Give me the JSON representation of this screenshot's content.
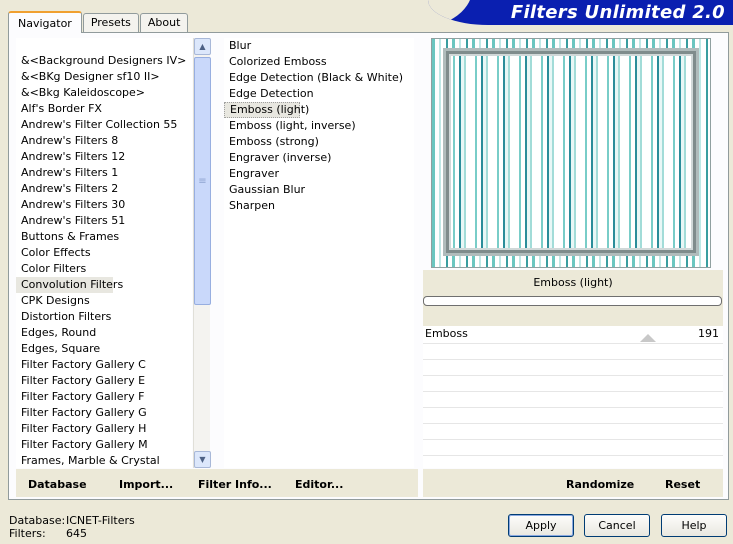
{
  "tabs": [
    {
      "label": "Navigator",
      "active": true
    },
    {
      "label": "Presets",
      "active": false
    },
    {
      "label": "About",
      "active": false
    }
  ],
  "brand": {
    "title": "Filters Unlimited 2.0",
    "color": "#0a1fb0"
  },
  "categories": {
    "items": [
      "&<Background Designers IV>",
      "&<BKg Designer sf10 II>",
      "&<Bkg Kaleidoscope>",
      "Alf's Border FX",
      "Andrew's Filter Collection 55",
      "Andrew's Filters  8",
      "Andrew's Filters 12",
      "Andrew's Filters 1",
      "Andrew's Filters 2",
      "Andrew's Filters 30",
      "Andrew's Filters 51",
      "Buttons & Frames",
      "Color Effects",
      "Color Filters",
      "Convolution Filters",
      "CPK Designs",
      "Distortion Filters",
      "Edges, Round",
      "Edges, Square",
      "Filter Factory Gallery C",
      "Filter Factory Gallery E",
      "Filter Factory Gallery F",
      "Filter Factory Gallery G",
      "Filter Factory Gallery H",
      "Filter Factory Gallery M",
      "Frames, Marble & Crystal"
    ],
    "selected": "Convolution Filters"
  },
  "filters": {
    "items": [
      "Blur",
      "Colorized Emboss",
      "Edge Detection (Black & White)",
      "Edge Detection",
      "Emboss (light)",
      "Emboss (light, inverse)",
      "Emboss (strong)",
      "Engraver (inverse)",
      "Engraver",
      "Gaussian Blur",
      "Sharpen"
    ],
    "selected": "Emboss (light)"
  },
  "preview": {
    "filter_name": "Emboss (light)"
  },
  "params": [
    {
      "label": "Emboss",
      "value": "191",
      "level": 0.75
    }
  ],
  "toolbar": {
    "database": "Database",
    "import": "Import...",
    "filter_info": "Filter Info...",
    "editor": "Editor...",
    "randomize": "Randomize",
    "reset": "Reset"
  },
  "status": {
    "database_label": "Database:",
    "database_value": "ICNET-Filters",
    "filters_label": "Filters:",
    "filters_value": "645"
  },
  "buttons": {
    "apply": "Apply",
    "cancel": "Cancel",
    "help": "Help"
  }
}
